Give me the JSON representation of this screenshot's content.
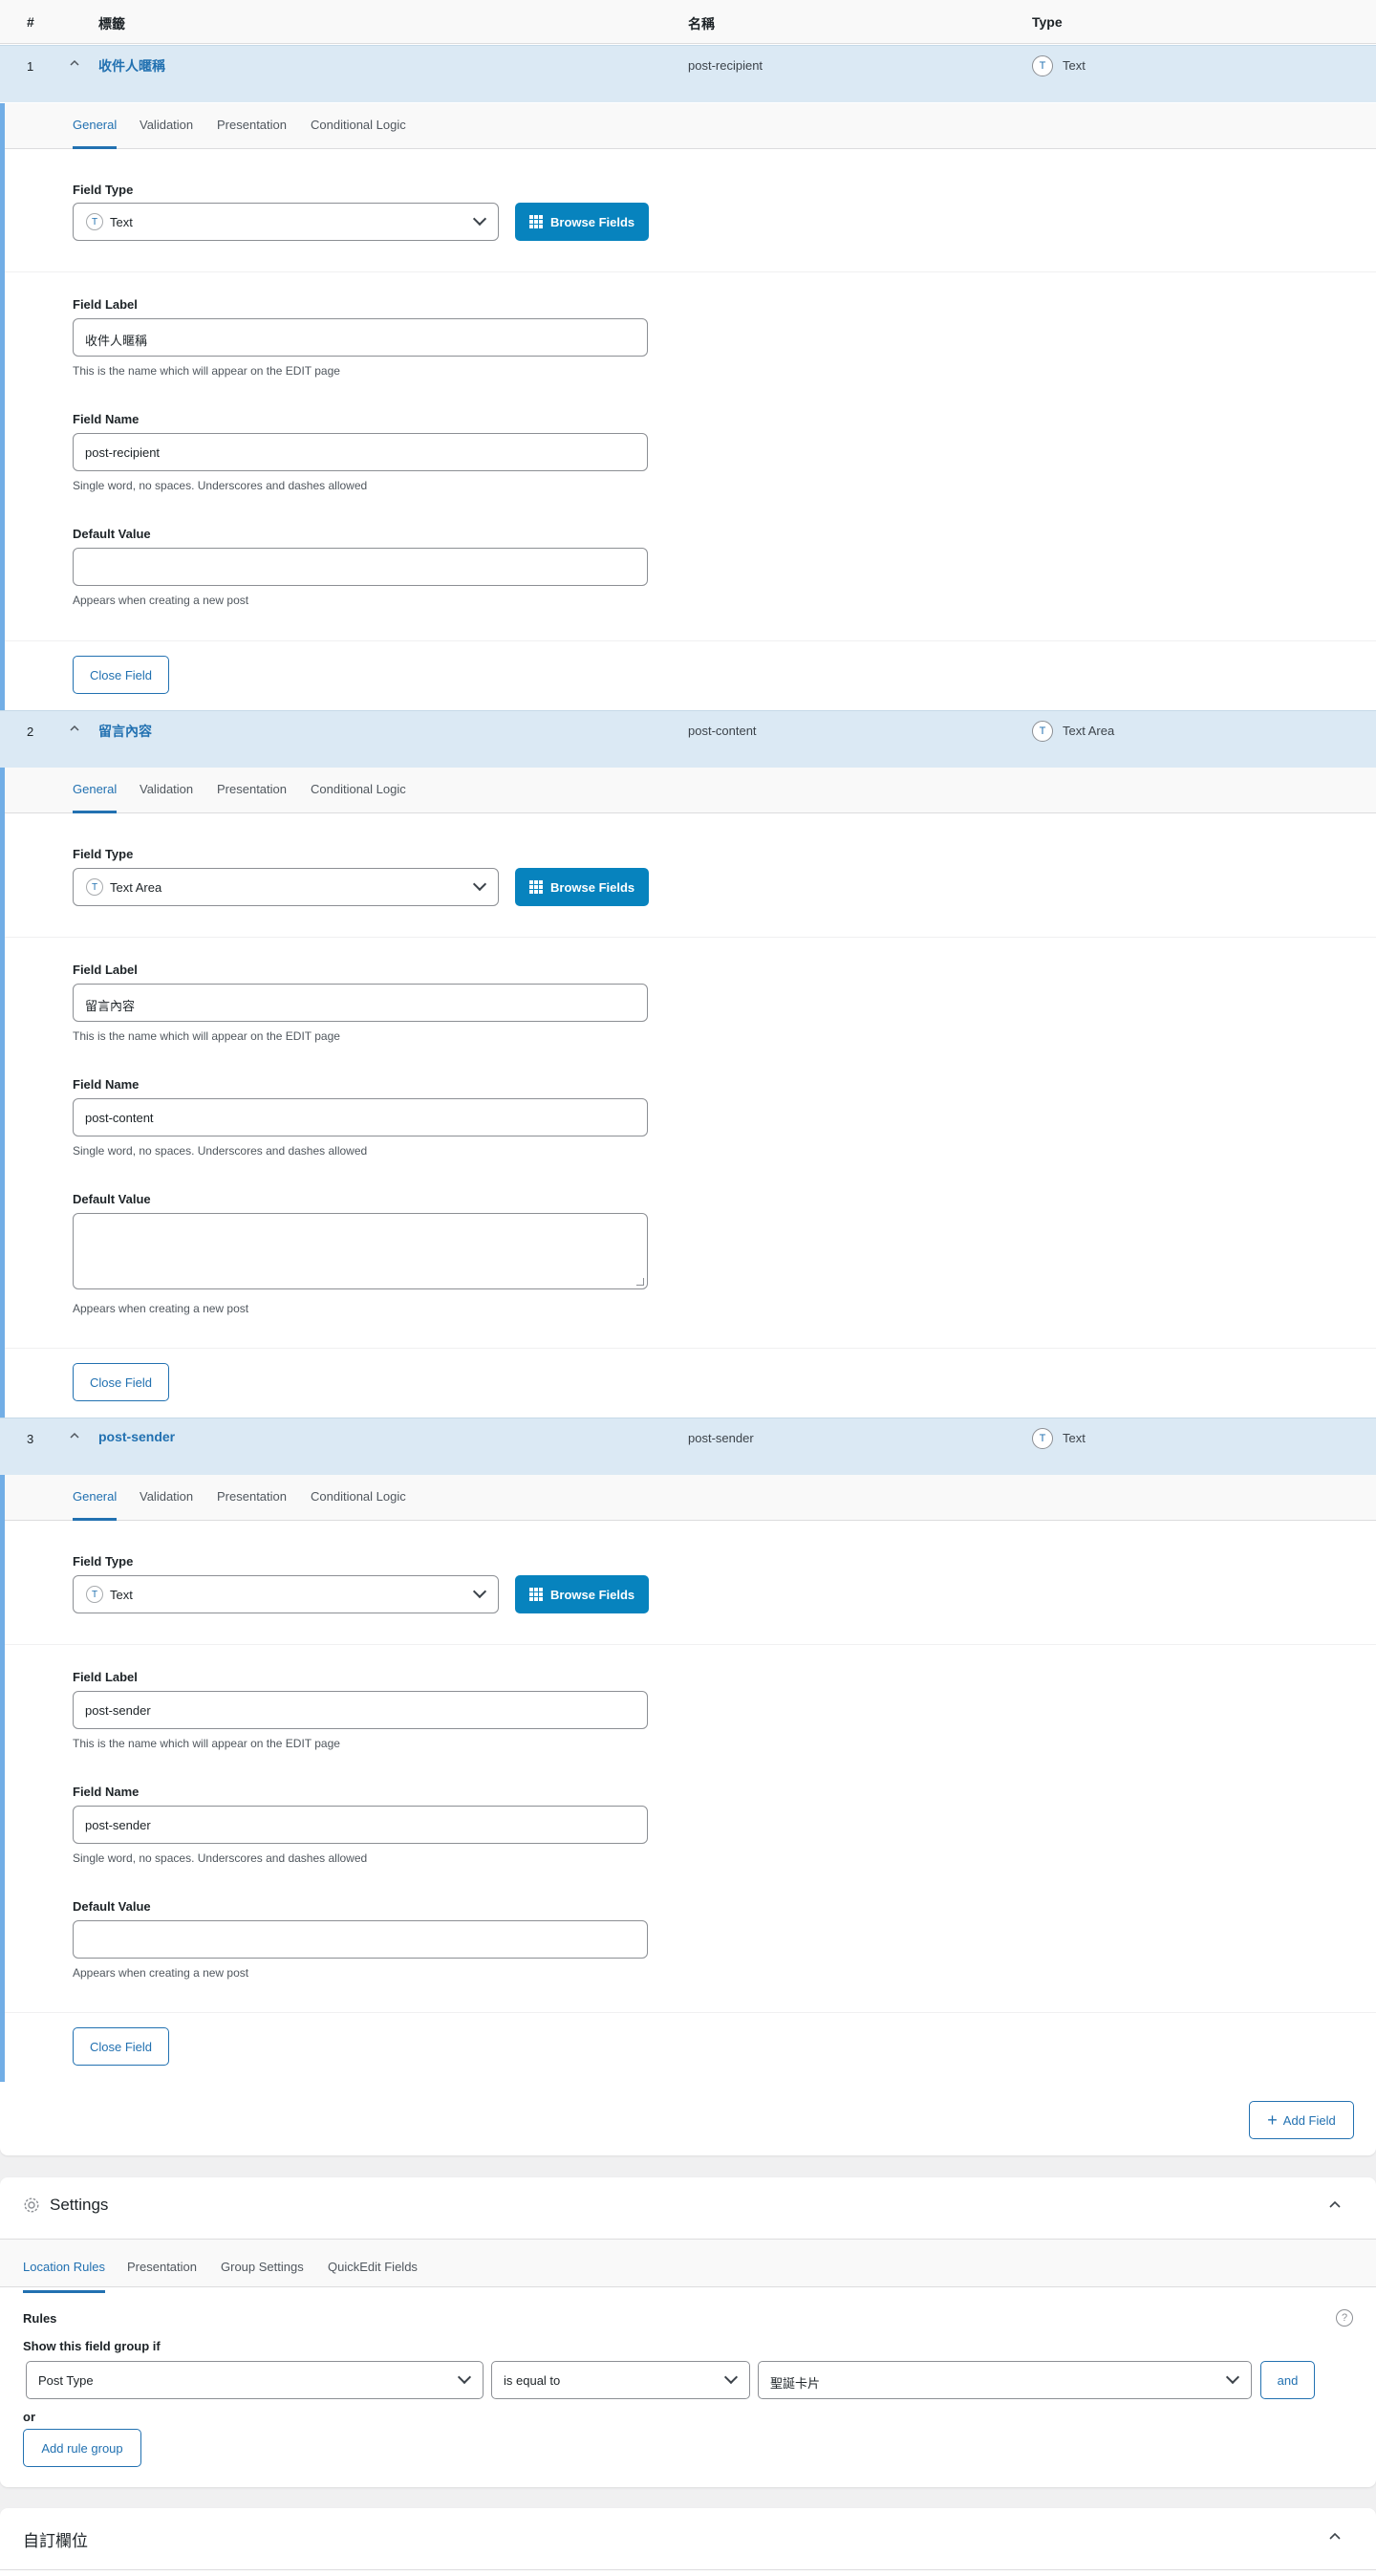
{
  "table_header": {
    "num": "#",
    "label": "標籤",
    "name": "名稱",
    "type": "Type"
  },
  "tabs": [
    "General",
    "Validation",
    "Presentation",
    "Conditional Logic"
  ],
  "common": {
    "field_type_label": "Field Type",
    "browse_label": "Browse Fields",
    "field_label_label": "Field Label",
    "field_label_help": "This is the name which will appear on the EDIT page",
    "field_name_label": "Field Name",
    "field_name_help": "Single word, no spaces. Underscores and dashes allowed",
    "default_value_label": "Default Value",
    "default_value_help": "Appears when creating a new post",
    "close_label": "Close Field"
  },
  "fields": [
    {
      "num": "1",
      "label": "收件人暱稱",
      "name": "post-recipient",
      "type": "Text",
      "type_icon": "text-icon",
      "type_glyph": "T",
      "field_label_value": "收件人暱稱",
      "field_name_value": "post-recipient",
      "default_value": ""
    },
    {
      "num": "2",
      "label": "留言內容",
      "name": "post-content",
      "type": "Text Area",
      "type_icon": "textarea-icon",
      "type_glyph": "T",
      "field_label_value": "留言內容",
      "field_name_value": "post-content",
      "default_value": ""
    },
    {
      "num": "3",
      "label": "post-sender",
      "name": "post-sender",
      "type": "Text",
      "type_icon": "text-icon",
      "type_glyph": "T",
      "field_label_value": "post-sender",
      "field_name_value": "post-sender",
      "default_value": ""
    }
  ],
  "add_field_label": "Add Field",
  "settings": {
    "title": "Settings",
    "tabs": [
      "Location Rules",
      "Presentation",
      "Group Settings",
      "QuickEdit Fields"
    ],
    "rules_label": "Rules",
    "show_if": "Show this field group if",
    "param": "Post Type",
    "operator": "is equal to",
    "value": "聖誕卡片",
    "and_label": "and",
    "or_label": "or",
    "add_rule_group": "Add rule group"
  },
  "custom_fields_title": "自訂欄位",
  "colors": {
    "accent": "#2271b1",
    "browse": "#0783be",
    "row_bg": "#dbe9f4",
    "panel_border": "#72aee6"
  }
}
